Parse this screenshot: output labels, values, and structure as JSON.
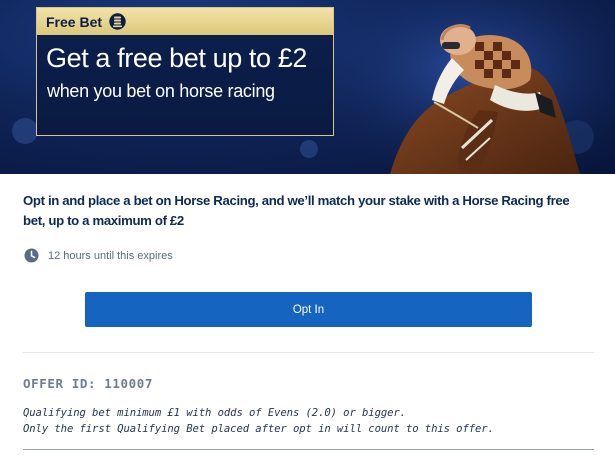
{
  "banner": {
    "tag_label": "Free Bet",
    "headline": "Get a free bet up to £2",
    "subline": "when you bet on horse racing",
    "image": "horse-racing-jockey-image"
  },
  "offer": {
    "description": "Opt in and place a bet on Horse Racing, and we’ll match your stake with a Horse Racing free bet, up to a maximum of £2",
    "expiry_text": "12 hours until this expires",
    "opt_in_label": "Opt In",
    "id_label": "OFFER ID: 110007",
    "terms": [
      "Qualifying bet minimum £1 with odds of Evens (2.0) or bigger.",
      "Only the first Qualifying Bet placed after opt in will count to this offer."
    ]
  },
  "icons": {
    "tag": "free-bet-coin-icon",
    "expiry": "clock-icon"
  },
  "colors": {
    "banner_bg": "#0f2458",
    "tag_gold": "#e8d48e",
    "text_navy": "#0d2a57",
    "button_blue": "#1565c0"
  }
}
